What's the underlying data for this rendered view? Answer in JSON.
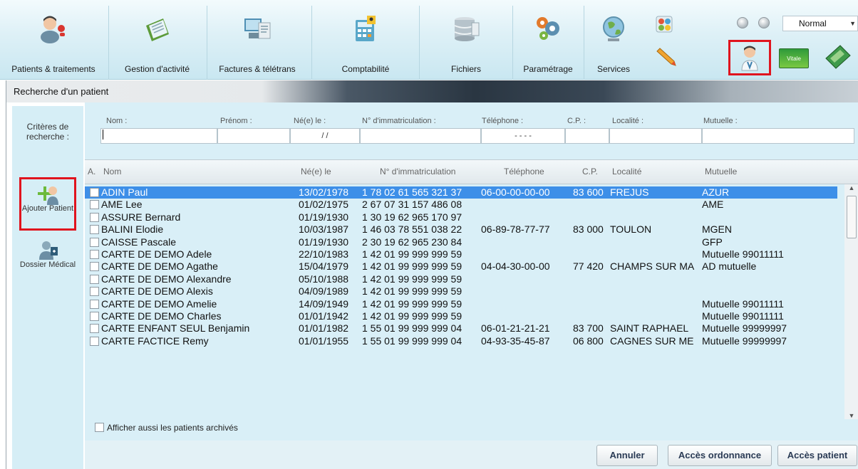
{
  "toolbar": {
    "items": [
      {
        "label": "Patients & traitements",
        "icon": "patients-icon"
      },
      {
        "label": "Gestion d'activité",
        "icon": "activity-icon"
      },
      {
        "label": "Factures & télétrans",
        "icon": "invoice-icon"
      },
      {
        "label": "Comptabilité",
        "icon": "accounting-icon"
      },
      {
        "label": "Fichiers",
        "icon": "files-icon"
      },
      {
        "label": "Paramétrage",
        "icon": "settings-icon"
      },
      {
        "label": "Services",
        "icon": "globe-icon"
      }
    ],
    "view_mode": "Normal",
    "vitale_label": "Vitale"
  },
  "window": {
    "title": "Recherche d'un patient"
  },
  "sidebar": {
    "criteria_label": "Critères de recherche :",
    "add_patient": "Ajouter Patient",
    "dossier": "Dossier Médical"
  },
  "search": {
    "labels": {
      "nom": "Nom :",
      "prenom": "Prénom :",
      "ne": "Né(e) le :",
      "immat": "N° d'immatriculation :",
      "tel": "Téléphone :",
      "cp": "C.P. :",
      "localite": "Localité :",
      "mutuelle": "Mutuelle :"
    },
    "values": {
      "ne": "/ /",
      "tel": "- - - -"
    }
  },
  "table": {
    "headers": {
      "a": "A.",
      "nom": "Nom",
      "ne": "Né(e) le",
      "immat": "N° d'immatriculation",
      "tel": "Téléphone",
      "cp": "C.P.",
      "localite": "Localité",
      "mutuelle": "Mutuelle"
    },
    "rows": [
      {
        "nom": "ADIN Paul",
        "ne": "13/02/1978",
        "immat": "1 78 02 61 565 321 37",
        "tel": "06-00-00-00-00",
        "cp": "83 600",
        "loc": "FREJUS",
        "mut": "AZUR",
        "selected": true
      },
      {
        "nom": "AME Lee",
        "ne": "01/02/1975",
        "immat": "2 67 07 31 157 486 08",
        "tel": "",
        "cp": "",
        "loc": "",
        "mut": "AME"
      },
      {
        "nom": "ASSURE Bernard",
        "ne": "01/19/1930",
        "immat": "1 30 19 62 965 170 97",
        "tel": "",
        "cp": "",
        "loc": "",
        "mut": ""
      },
      {
        "nom": "BALINI Elodie",
        "ne": "10/03/1987",
        "immat": "1 46 03 78 551 038 22",
        "tel": "06-89-78-77-77",
        "cp": "83 000",
        "loc": "TOULON",
        "mut": "MGEN"
      },
      {
        "nom": "CAISSE Pascale",
        "ne": "01/19/1930",
        "immat": "2 30 19 62 965 230 84",
        "tel": "",
        "cp": "",
        "loc": "",
        "mut": "GFP"
      },
      {
        "nom": "CARTE DE DEMO Adele",
        "ne": "22/10/1983",
        "immat": "1 42 01 99 999 999 59",
        "tel": "",
        "cp": "",
        "loc": "",
        "mut": "Mutuelle 99011111"
      },
      {
        "nom": "CARTE DE DEMO Agathe",
        "ne": "15/04/1979",
        "immat": "1 42 01 99 999 999 59",
        "tel": "04-04-30-00-00",
        "cp": "77 420",
        "loc": "CHAMPS SUR MA",
        "mut": "AD mutuelle"
      },
      {
        "nom": "CARTE DE DEMO Alexandre",
        "ne": "05/10/1988",
        "immat": "1 42 01 99 999 999 59",
        "tel": "",
        "cp": "",
        "loc": "",
        "mut": ""
      },
      {
        "nom": "CARTE DE DEMO Alexis",
        "ne": "04/09/1989",
        "immat": "1 42 01 99 999 999 59",
        "tel": "",
        "cp": "",
        "loc": "",
        "mut": ""
      },
      {
        "nom": "CARTE DE DEMO Amelie",
        "ne": "14/09/1949",
        "immat": "1 42 01 99 999 999 59",
        "tel": "",
        "cp": "",
        "loc": "",
        "mut": "Mutuelle 99011111"
      },
      {
        "nom": "CARTE DE DEMO Charles",
        "ne": "01/01/1942",
        "immat": "1 42 01 99 999 999 59",
        "tel": "",
        "cp": "",
        "loc": "",
        "mut": "Mutuelle 99011111"
      },
      {
        "nom": "CARTE ENFANT SEUL Benjamin",
        "ne": "01/01/1982",
        "immat": "1 55 01 99 999 999 04",
        "tel": "06-01-21-21-21",
        "cp": "83 700",
        "loc": "SAINT RAPHAEL",
        "mut": "Mutuelle 99999997"
      },
      {
        "nom": "CARTE FACTICE Remy",
        "ne": "01/01/1955",
        "immat": "1 55 01 99 999 999 04",
        "tel": "04-93-35-45-87",
        "cp": "06 800",
        "loc": "CAGNES SUR ME",
        "mut": "Mutuelle 99999997"
      }
    ]
  },
  "archive_label": "Afficher aussi les patients archivés",
  "buttons": {
    "cancel": "Annuler",
    "prescription": "Accès ordonnance",
    "patient": "Accès patient"
  },
  "colors": {
    "selection": "#3d8fe8",
    "highlight_box": "#e0141e",
    "panel": "#d9eff7"
  }
}
